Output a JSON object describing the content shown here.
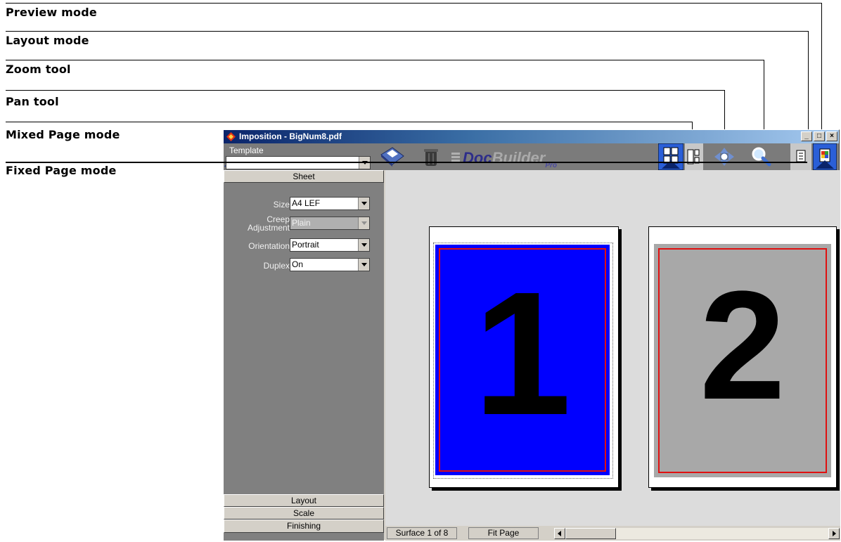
{
  "callouts": {
    "preview_mode": "Preview mode",
    "layout_mode": "Layout mode",
    "zoom_tool": "Zoom tool",
    "pan_tool": "Pan tool",
    "mixed_page_mode": "Mixed Page mode",
    "fixed_page_mode": "Fixed Page mode"
  },
  "window": {
    "title": "Imposition - BigNum8.pdf",
    "controls": [
      "_",
      "□",
      "×"
    ]
  },
  "toolbar": {
    "template_label": "Template",
    "template_value": "",
    "brand_doc": "Doc",
    "brand_builder": "Builder",
    "brand_pro": "Pro",
    "icons": [
      "save-icon",
      "trash-icon",
      "mixed-page-mode-icon",
      "fixed-page-mode-icon",
      "pan-tool-icon",
      "zoom-tool-icon",
      "layout-mode-icon",
      "preview-mode-icon"
    ]
  },
  "sheet_panel": {
    "title": "Sheet",
    "fields": [
      {
        "label": "Size",
        "value": "A4 LEF"
      },
      {
        "label": "Creep Adjustment",
        "value": "Plain"
      },
      {
        "label": "Orientation",
        "value": "Portrait"
      },
      {
        "label": "Duplex",
        "value": "On"
      }
    ],
    "sections": [
      "Layout",
      "Scale",
      "Finishing"
    ]
  },
  "pages": [
    {
      "number": "1",
      "color": "#0000ff"
    },
    {
      "number": "2",
      "color": "#a8a8a8"
    }
  ],
  "status": {
    "surface": "Surface 1 of 8",
    "fit": "Fit Page"
  }
}
